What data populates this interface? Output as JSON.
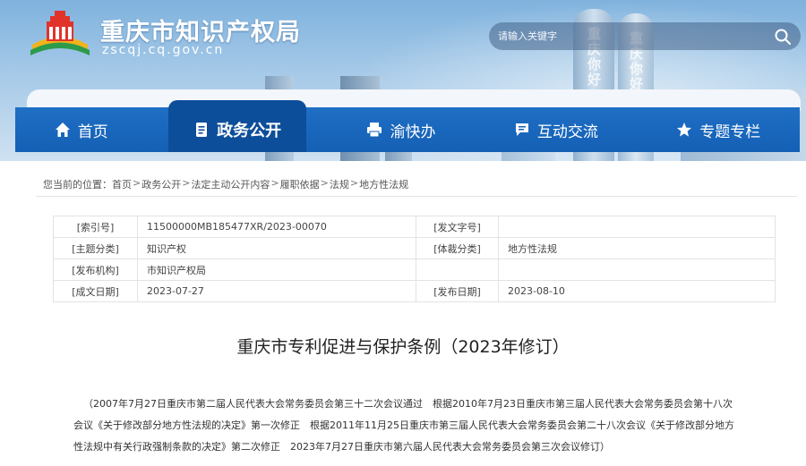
{
  "header": {
    "site_title": "重庆市知识产权局",
    "site_domain": "zscqj.cq.gov.cn",
    "tower_text_1": "重庆你好",
    "tower_text_2": "重庆你好",
    "search": {
      "placeholder": "请输入关键字",
      "icon": "search-icon"
    }
  },
  "nav": {
    "items": [
      {
        "label": "首页",
        "icon": "home-icon",
        "active": false
      },
      {
        "label": "政务公开",
        "icon": "document-icon",
        "active": true
      },
      {
        "label": "渝快办",
        "icon": "printer-icon",
        "active": false
      },
      {
        "label": "互动交流",
        "icon": "chat-icon",
        "active": false
      },
      {
        "label": "专题专栏",
        "icon": "star-icon",
        "active": false
      }
    ]
  },
  "breadcrumb": {
    "prefix": "您当前的位置：",
    "items": [
      "首页",
      "政务公开",
      "法定主动公开内容",
      "履职依据",
      "法规",
      "地方性法规"
    ],
    "separator": ">"
  },
  "info": {
    "rows": [
      {
        "l1": "[索引号]",
        "v1": "11500000MB185477XR/2023-00070",
        "l2": "[发文字号]",
        "v2": ""
      },
      {
        "l1": "[主题分类]",
        "v1": "知识产权",
        "l2": "[体裁分类]",
        "v2": "地方性法规"
      },
      {
        "l1": "[发布机构]",
        "v1": "市知识产权局",
        "l2": "",
        "v2": ""
      },
      {
        "l1": "[成文日期]",
        "v1": "2023-07-27",
        "l2": "[发布日期]",
        "v2": "2023-08-10"
      }
    ]
  },
  "document": {
    "title": "重庆市专利促进与保护条例（2023年修订）",
    "preamble": "（2007年7月27日重庆市第二届人民代表大会常务委员会第三十二次会议通过　根据2010年7月23日重庆市第三届人民代表大会常务委员会第十八次会议《关于修改部分地方性法规的决定》第一次修正　根据2011年11月25日重庆市第三届人民代表大会常务委员会第二十八次会议《关于修改部分地方性法规中有关行政强制条款的决定》第二次修正　2023年7月27日重庆市第六届人民代表大会常务委员会第三次会议修订）"
  },
  "colors": {
    "nav_bg": "#1460b5",
    "nav_active": "#0d4e9a",
    "banner_sky": "#a5c9e8"
  }
}
